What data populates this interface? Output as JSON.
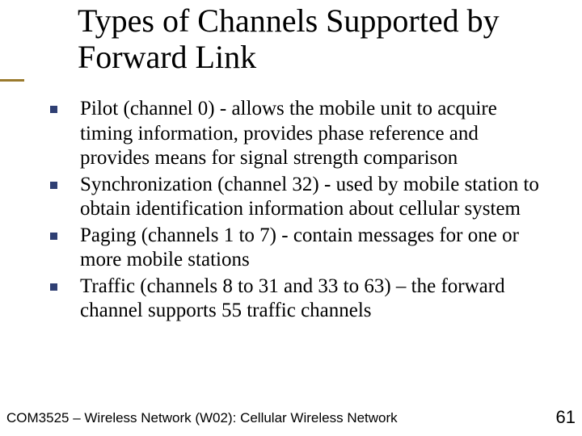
{
  "title": "Types of Channels Supported by Forward Link",
  "bullets": [
    "Pilot (channel 0) - allows the mobile unit to acquire timing information, provides phase reference and provides means for signal strength comparison",
    "Synchronization (channel 32) - used by mobile station to obtain identification information about cellular system",
    "Paging (channels 1 to 7) - contain messages for one or more mobile stations",
    "Traffic (channels 8 to 31 and 33 to 63) – the forward channel supports 55 traffic channels"
  ],
  "footer": "COM3525 – Wireless Network (W02): Cellular Wireless Network",
  "page": "61"
}
